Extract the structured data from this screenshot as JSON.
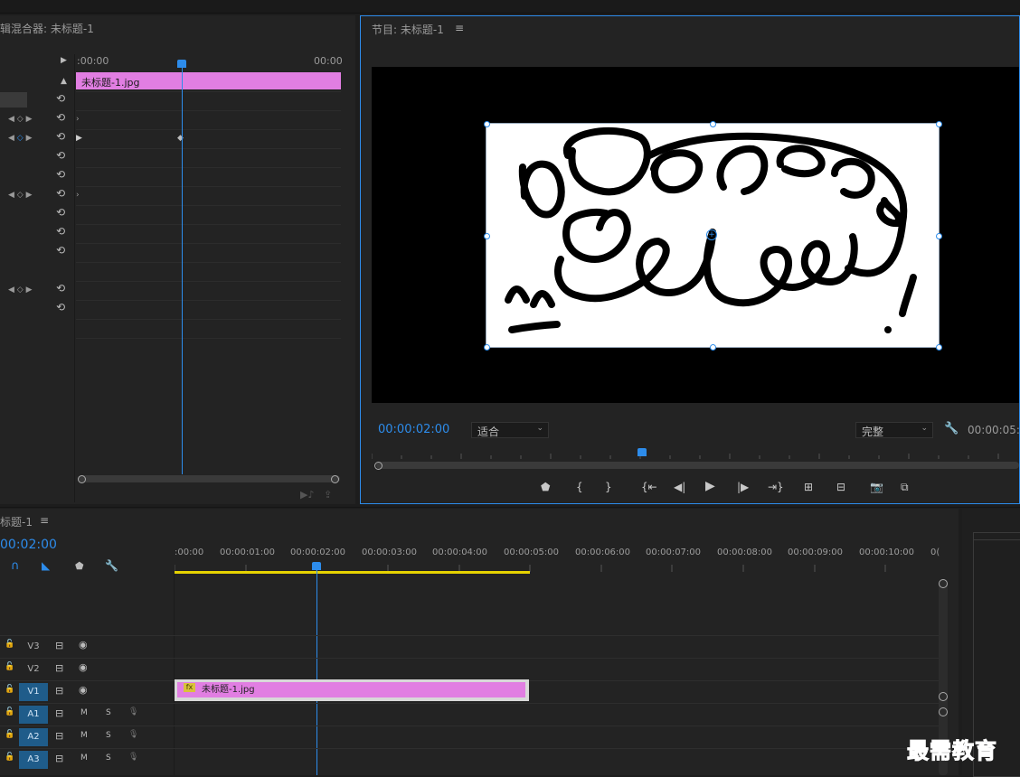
{
  "top_bar": {},
  "effect_controls": {
    "title": "辑混合器: 未标题-1",
    "ruler_start": ":00:00",
    "ruler_end": "00:00",
    "clip_label": "未标题-1.jpg"
  },
  "program_monitor": {
    "title": "节目: 未标题-1",
    "menu_icon": "hamburger-icon",
    "timecode": "00:00:02:00",
    "fit_select": "适合",
    "quality_select": "完整",
    "end_timecode": "00:00:05:",
    "playhead_fraction": 0.41
  },
  "timeline": {
    "title": "标题-1",
    "timecode": "00:02:00",
    "ruler_labels": [
      ":00:00",
      "00:00:01:00",
      "00:00:02:00",
      "00:00:03:00",
      "00:00:04:00",
      "00:00:05:00",
      "00:00:06:00",
      "00:00:07:00",
      "00:00:08:00",
      "00:00:09:00",
      "00:00:10:00",
      "0("
    ],
    "tracks": [
      {
        "name": "V3",
        "kind": "video"
      },
      {
        "name": "V2",
        "kind": "video"
      },
      {
        "name": "V1",
        "kind": "video",
        "active": true
      },
      {
        "name": "A1",
        "kind": "audio",
        "active": true,
        "m": "M",
        "s": "S"
      },
      {
        "name": "A2",
        "kind": "audio",
        "active": true,
        "m": "M",
        "s": "S"
      },
      {
        "name": "A3",
        "kind": "audio",
        "active": true,
        "m": "M",
        "s": "S"
      }
    ],
    "clip": {
      "fx": "fx",
      "label": "未标题-1.jpg"
    }
  },
  "watermark": "最需教育",
  "colors": {
    "accent": "#2d8ceb",
    "clip": "#e17ee2",
    "work_area": "#e6d200"
  }
}
